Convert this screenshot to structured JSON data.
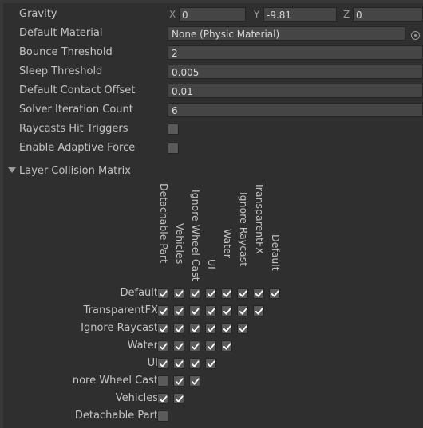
{
  "physics": {
    "gravity": {
      "label": "Gravity",
      "x_label": "X",
      "x": "0",
      "y_label": "Y",
      "y": "-9.81",
      "z_label": "Z",
      "z": "0"
    },
    "default_material": {
      "label": "Default Material",
      "value": "None (Physic Material)",
      "picker_icon": "object-picker-icon"
    },
    "bounce_threshold": {
      "label": "Bounce Threshold",
      "value": "2"
    },
    "sleep_threshold": {
      "label": "Sleep Threshold",
      "value": "0.005"
    },
    "default_contact_offset": {
      "label": "Default Contact Offset",
      "value": "0.01"
    },
    "solver_iteration_count": {
      "label": "Solver Iteration Count",
      "value": "6"
    },
    "raycasts_hit_triggers": {
      "label": "Raycasts Hit Triggers",
      "checked": false
    },
    "enable_adaptive_force": {
      "label": "Enable Adaptive Force",
      "checked": false
    }
  },
  "matrix": {
    "title": "Layer Collision Matrix",
    "columns": [
      "Detachable Part",
      "Vehicles",
      "Ignore Wheel Cast",
      "UI",
      "Water",
      "Ignore Raycast",
      "TransparentFX",
      "Default"
    ],
    "rows": [
      {
        "label": "Default",
        "checks": [
          true,
          true,
          true,
          true,
          true,
          true,
          true,
          true
        ]
      },
      {
        "label": "TransparentFX",
        "checks": [
          true,
          true,
          true,
          true,
          true,
          true,
          true
        ]
      },
      {
        "label": "Ignore Raycast",
        "checks": [
          true,
          true,
          true,
          true,
          true,
          true
        ]
      },
      {
        "label": "Water",
        "checks": [
          true,
          true,
          true,
          true,
          true
        ]
      },
      {
        "label": "UI",
        "checks": [
          true,
          true,
          true,
          true
        ]
      },
      {
        "label": "nore Wheel Cast",
        "checks": [
          false,
          true,
          true
        ]
      },
      {
        "label": "Vehicles",
        "checks": [
          true,
          true
        ]
      },
      {
        "label": "Detachable Part",
        "checks": [
          false
        ]
      }
    ]
  },
  "colors": {
    "panel": "#2f2f2f",
    "field": "#454545",
    "text": "#c4c4c4",
    "check": "#ffffff"
  }
}
